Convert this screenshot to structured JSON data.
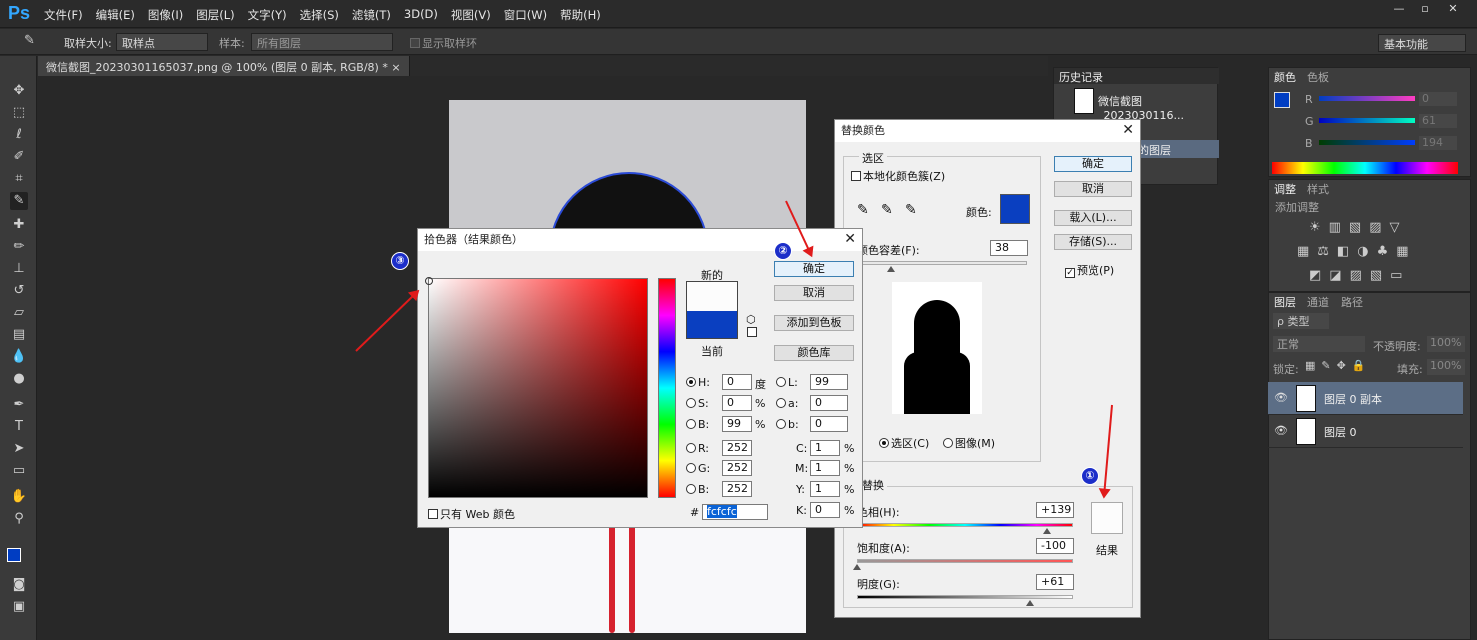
{
  "app": {
    "logo": "Ps"
  },
  "menu": [
    "文件(F)",
    "编辑(E)",
    "图像(I)",
    "图层(L)",
    "文字(Y)",
    "选择(S)",
    "滤镜(T)",
    "3D(D)",
    "视图(V)",
    "窗口(W)",
    "帮助(H)"
  ],
  "options": {
    "sample_size_label": "取样大小:",
    "sample_size_value": "取样点",
    "sample_label": "样本:",
    "sample_value": "所有图层",
    "show_ring": "显示取样环",
    "workspace": "基本功能"
  },
  "doc_tab": "微信截图_20230301165037.png @ 100% (图层 0 副本, RGB/8) *",
  "doc_tab_close": "×",
  "history": {
    "tab": "历史记录",
    "item": "微信截图_2023030116...",
    "item2": "的图层"
  },
  "color_panel": {
    "tab1": "颜色",
    "tab2": "色板",
    "r_label": "R",
    "g_label": "G",
    "b_label": "B",
    "r": "0",
    "g": "61",
    "b": "194",
    "fg_color": "#003dc2"
  },
  "adjust_panel": {
    "tab1": "调整",
    "tab2": "样式",
    "add": "添加调整"
  },
  "layers_panel": {
    "tab1": "图层",
    "tab2": "通道",
    "tab3": "路径",
    "kind": "ρ 类型",
    "blend": "正常",
    "opacity_label": "不透明度:",
    "opacity": "100%",
    "lock_label": "锁定:",
    "fill_label": "填充:",
    "fill": "100%",
    "layers": [
      {
        "name": "图层 0 副本",
        "selected": true
      },
      {
        "name": "图层 0",
        "selected": false
      }
    ]
  },
  "picker": {
    "title": "拾色器（结果颜色）",
    "ok": "确定",
    "cancel": "取消",
    "add_swatch": "添加到色板",
    "library": "颜色库",
    "new_label": "新的",
    "current_label": "当前",
    "new_color": "#fcfcfc",
    "current_color": "#0a3fc0",
    "web_only": "只有 Web 颜色",
    "hash": "#",
    "hex": "fcfcfc",
    "h_label": "H:",
    "h": "0",
    "h_unit": "度",
    "s_label": "S:",
    "s": "0",
    "s_unit": "%",
    "b_label": "B:",
    "b": "99",
    "b_unit": "%",
    "r_label": "R:",
    "r": "252",
    "g_label": "G:",
    "g": "252",
    "bb_label": "B:",
    "bb": "252",
    "l_label": "L:",
    "l": "99",
    "a_label": "a:",
    "a": "0",
    "lb_label": "b:",
    "lb": "0",
    "c_label": "C:",
    "c": "1",
    "m_label": "M:",
    "m": "1",
    "y_label": "Y:",
    "y": "1",
    "k_label": "K:",
    "k": "0",
    "pct": "%"
  },
  "replace": {
    "title": "替换颜色",
    "sel_legend": "选区",
    "localized": "本地化颜色簇(Z)",
    "color_label": "颜色:",
    "sel_color": "#0a3fc0",
    "fuzz_label": "颜色容差(F):",
    "fuzz": "38",
    "fuzz_fraction": 0.2,
    "ok": "确定",
    "cancel": "取消",
    "load": "载入(L)...",
    "save": "存储(S)...",
    "preview": "预览(P)",
    "r_selection": "选区(C)",
    "r_image": "图像(M)",
    "repl_legend": "替换",
    "hue_label": "色相(H):",
    "hue": "+139",
    "hue_fraction": 0.88,
    "sat_label": "饱和度(A):",
    "sat": "-100",
    "sat_fraction": 0.0,
    "light_label": "明度(G):",
    "light": "+61",
    "light_fraction": 0.8,
    "result_label": "结果",
    "result_color": "#fcfcfc"
  },
  "badges": [
    "①",
    "②",
    "③"
  ],
  "accent": "#e01b1b"
}
